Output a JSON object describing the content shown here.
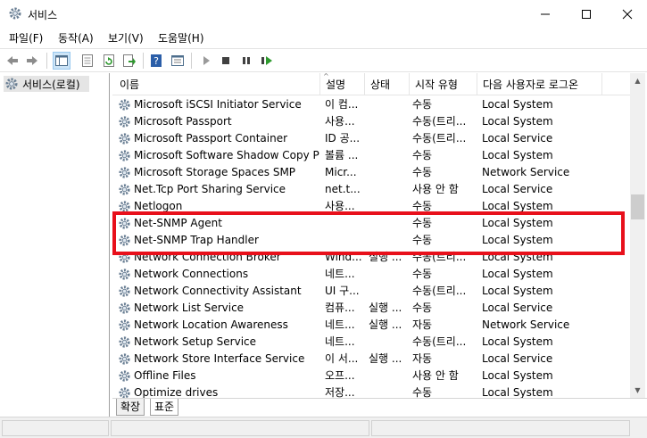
{
  "window": {
    "title": "서비스",
    "minimize_icon": "minimize-icon",
    "maximize_icon": "maximize-icon",
    "close_icon": "close-icon"
  },
  "menu": [
    {
      "label": "파일(F)"
    },
    {
      "label": "동작(A)"
    },
    {
      "label": "보기(V)"
    },
    {
      "label": "도움말(H)"
    }
  ],
  "toolbar": {
    "icons": [
      "back-arrow-icon",
      "forward-arrow-icon",
      "console-tree-icon",
      "properties-icon",
      "refresh-icon",
      "export-list-icon",
      "help-icon",
      "details-view-icon",
      "play-icon",
      "stop-icon",
      "pause-icon",
      "restart-icon"
    ]
  },
  "tree": {
    "item_label": "서비스(로컬)"
  },
  "columns": {
    "name": "이름",
    "desc": "설명",
    "state": "상태",
    "start": "시작 유형",
    "logon": "다음 사용자로 로그온"
  },
  "rows": [
    {
      "name": "Microsoft iSCSI Initiator Service",
      "desc": "이 컴...",
      "state": "",
      "start": "수동",
      "logon": "Local System"
    },
    {
      "name": "Microsoft Passport",
      "desc": "사용...",
      "state": "",
      "start": "수동(트리...",
      "logon": "Local System"
    },
    {
      "name": "Microsoft Passport Container",
      "desc": "ID 공...",
      "state": "",
      "start": "수동(트리...",
      "logon": "Local Service"
    },
    {
      "name": "Microsoft Software Shadow Copy Pr...",
      "desc": "볼륨 ...",
      "state": "",
      "start": "수동",
      "logon": "Local System"
    },
    {
      "name": "Microsoft Storage Spaces SMP",
      "desc": "Micr...",
      "state": "",
      "start": "수동",
      "logon": "Network Service"
    },
    {
      "name": "Net.Tcp Port Sharing Service",
      "desc": "net.t...",
      "state": "",
      "start": "사용 안 함",
      "logon": "Local Service"
    },
    {
      "name": "Netlogon",
      "desc": "사용...",
      "state": "",
      "start": "수동",
      "logon": "Local System"
    },
    {
      "name": "Net-SNMP Agent",
      "desc": "",
      "state": "",
      "start": "수동",
      "logon": "Local System"
    },
    {
      "name": "Net-SNMP Trap Handler",
      "desc": "",
      "state": "",
      "start": "수동",
      "logon": "Local System"
    },
    {
      "name": "Network Connection Broker",
      "desc": "Wind...",
      "state": "실행 ...",
      "start": "수동(트리...",
      "logon": "Local System"
    },
    {
      "name": "Network Connections",
      "desc": "네트...",
      "state": "",
      "start": "수동",
      "logon": "Local System"
    },
    {
      "name": "Network Connectivity Assistant",
      "desc": "UI 구...",
      "state": "",
      "start": "수동(트리...",
      "logon": "Local System"
    },
    {
      "name": "Network List Service",
      "desc": "컴퓨...",
      "state": "실행 ...",
      "start": "수동",
      "logon": "Local Service"
    },
    {
      "name": "Network Location Awareness",
      "desc": "네트...",
      "state": "실행 ...",
      "start": "자동",
      "logon": "Network Service"
    },
    {
      "name": "Network Setup Service",
      "desc": "네트...",
      "state": "",
      "start": "수동(트리...",
      "logon": "Local System"
    },
    {
      "name": "Network Store Interface Service",
      "desc": "이 서...",
      "state": "실행 ...",
      "start": "자동",
      "logon": "Local Service"
    },
    {
      "name": "Offline Files",
      "desc": "오프...",
      "state": "",
      "start": "사용 안 함",
      "logon": "Local System"
    },
    {
      "name": "Optimize drives",
      "desc": "저장...",
      "state": "",
      "start": "수동",
      "logon": "Local System"
    }
  ],
  "tabs": {
    "extended": "확장",
    "standard": "표준"
  },
  "highlight_color": "#e8101b"
}
